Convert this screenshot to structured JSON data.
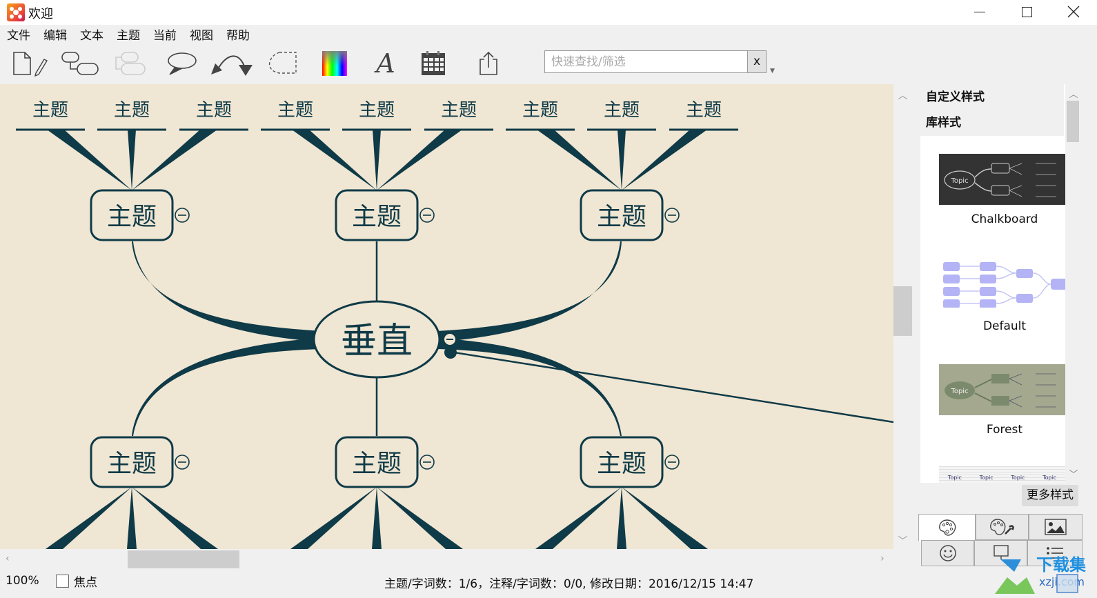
{
  "window": {
    "title": "欢迎",
    "minimize_icon": "minimize-icon",
    "maximize_icon": "maximize-icon",
    "close_icon": "close-icon"
  },
  "menu": [
    "文件",
    "编辑",
    "文本",
    "主题",
    "当前",
    "视图",
    "帮助"
  ],
  "toolbar": {
    "tools": [
      {
        "name": "new-document-icon"
      },
      {
        "name": "add-subtopic-icon"
      },
      {
        "name": "add-topic-disabled-icon"
      },
      {
        "name": "callout-icon"
      },
      {
        "name": "relationship-arrow-icon"
      },
      {
        "name": "boundary-icon"
      },
      {
        "name": "color-palette-icon"
      },
      {
        "name": "font-icon"
      },
      {
        "name": "calendar-icon"
      },
      {
        "name": "share-export-icon"
      }
    ],
    "search_placeholder": "快速查找/筛选",
    "search_value": "",
    "search_clear_label": "x"
  },
  "mindmap": {
    "central_topic": "垂直",
    "main_topics": [
      "主题",
      "主题",
      "主题",
      "主题",
      "主题",
      "主题"
    ],
    "subtopics": [
      "主题",
      "主题",
      "主题",
      "主题",
      "主题",
      "主题",
      "主题",
      "主题",
      "主题"
    ],
    "colors": {
      "background": "#efe6d3",
      "line": "#0f3a47"
    }
  },
  "right_panel": {
    "custom_styles_header": "自定义样式",
    "library_styles_header": "库样式",
    "styles": [
      {
        "label": "Chalkboard",
        "preview_topic": "Topic"
      },
      {
        "label": "Default",
        "preview_topic": "Topic"
      },
      {
        "label": "Forest",
        "preview_topic": "Topic"
      },
      {
        "label": "",
        "preview_topic": "Topic"
      }
    ],
    "more_styles_label": "更多样式",
    "tabs": [
      {
        "icon": "style-palette-icon"
      },
      {
        "icon": "custom-style-palette-icon"
      },
      {
        "icon": "image-icon"
      },
      {
        "icon": "smiley-icon"
      },
      {
        "icon": "presentation-icon"
      },
      {
        "icon": "outline-list-icon"
      }
    ]
  },
  "status": {
    "zoom": "100%",
    "focus_label": "焦点",
    "focus_checked": false,
    "info": "主题/字词数：1/6，注释/字词数：0/0, 修改日期：2016/12/15 14:47"
  },
  "watermark": {
    "brand": "下载集",
    "domain": "xzji.com"
  }
}
